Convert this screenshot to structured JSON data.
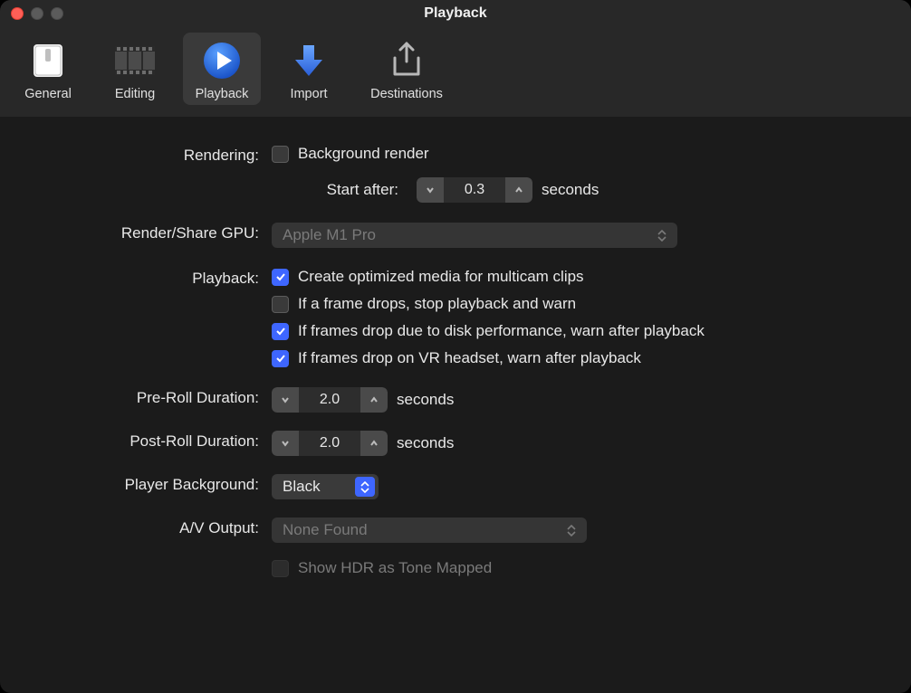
{
  "window": {
    "title": "Playback"
  },
  "toolbar": {
    "items": [
      {
        "label": "General"
      },
      {
        "label": "Editing"
      },
      {
        "label": "Playback"
      },
      {
        "label": "Import"
      },
      {
        "label": "Destinations"
      }
    ]
  },
  "sections": {
    "rendering": {
      "label": "Rendering:",
      "background_render_label": "Background render",
      "start_after_label": "Start after:",
      "start_after_value": "0.3",
      "start_after_unit": "seconds"
    },
    "render_gpu": {
      "label": "Render/Share GPU:",
      "value": "Apple M1 Pro"
    },
    "playback": {
      "label": "Playback:",
      "opt_optimized": "Create optimized media for multicam clips",
      "opt_frame_drop_stop": "If a frame drops, stop playback and warn",
      "opt_disk_warn": "If frames drop due to disk performance, warn after playback",
      "opt_vr_warn": "If frames drop on VR headset, warn after playback"
    },
    "preroll": {
      "label": "Pre-Roll Duration:",
      "value": "2.0",
      "unit": "seconds"
    },
    "postroll": {
      "label": "Post-Roll Duration:",
      "value": "2.0",
      "unit": "seconds"
    },
    "player_bg": {
      "label": "Player Background:",
      "value": "Black"
    },
    "av_output": {
      "label": "A/V Output:",
      "value": "None Found",
      "hdr_label": "Show HDR as Tone Mapped"
    }
  }
}
